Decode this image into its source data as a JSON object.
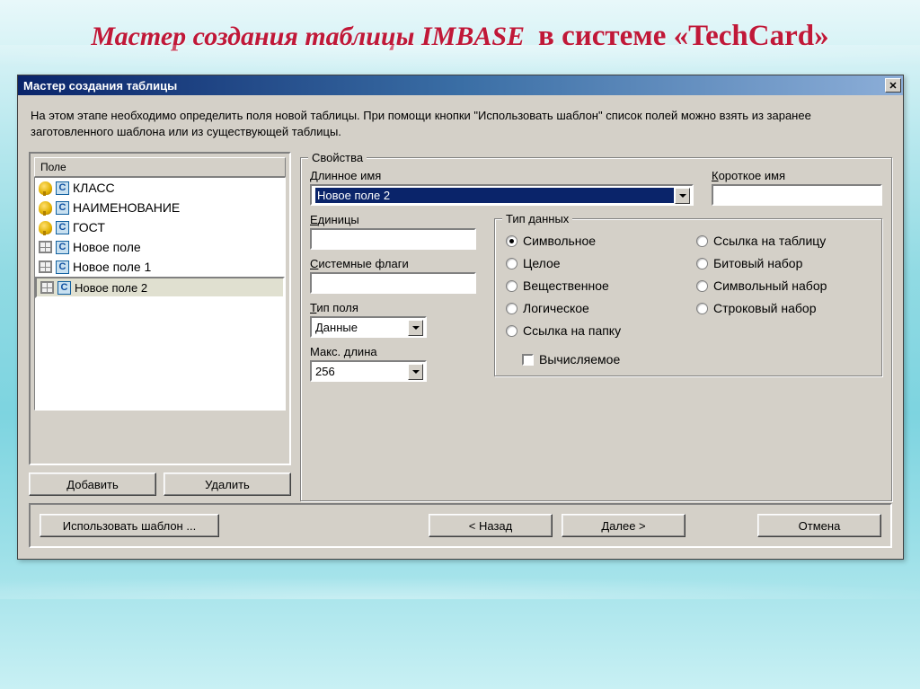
{
  "slide": {
    "title_a": "Мастер создания таблицы IMBASE",
    "title_b": "в системе «TechCard»"
  },
  "window": {
    "title": "Мастер создания таблицы",
    "description": "На этом этапе необходимо определить поля новой таблицы. При помощи кнопки \"Использовать шаблон\" список полей можно взять из заранее заготовленного шаблона или из существующей таблицы."
  },
  "fieldlist": {
    "header": "Поле",
    "items": [
      {
        "label": "КЛАСС",
        "key": true
      },
      {
        "label": "НАИМЕНОВАНИЕ",
        "key": true
      },
      {
        "label": "ГОСТ",
        "key": true
      },
      {
        "label": "Новое поле",
        "key": false
      },
      {
        "label": "Новое поле 1",
        "key": false
      },
      {
        "label": "Новое поле 2",
        "key": false,
        "selected": true
      }
    ],
    "add_btn": "Добавить",
    "remove_btn": "Удалить"
  },
  "props": {
    "legend": "Свойства",
    "long_name": {
      "label": "Длинное имя",
      "accel": "Д",
      "value": "Новое поле 2"
    },
    "short_name": {
      "label": "Короткое имя",
      "accel": "К",
      "value": ""
    },
    "units": {
      "label": "Единицы",
      "accel": "Е",
      "value": ""
    },
    "sysflags": {
      "label": "Системные флаги",
      "accel": "С",
      "value": ""
    },
    "fieldtype": {
      "label": "Тип поля",
      "accel": "Т",
      "value": "Данные"
    },
    "maxlen": {
      "label": "Макс. длина",
      "value": "256"
    },
    "datatype": {
      "legend": "Тип данных",
      "accel": "Т",
      "options": [
        {
          "label": "Символьное",
          "checked": true
        },
        {
          "label": "Ссылка на таблицу"
        },
        {
          "label": "Целое"
        },
        {
          "label": "Битовый набор"
        },
        {
          "label": "Вещественное"
        },
        {
          "label": "Символьный набор"
        },
        {
          "label": "Логическое"
        },
        {
          "label": "Строковый набор"
        },
        {
          "label": "Ссылка на папку"
        }
      ],
      "computed": "Вычисляемое"
    }
  },
  "footer": {
    "use_template": "Использовать шаблон ...",
    "back": "< Назад",
    "next": "Далее >",
    "cancel": "Отмена"
  }
}
